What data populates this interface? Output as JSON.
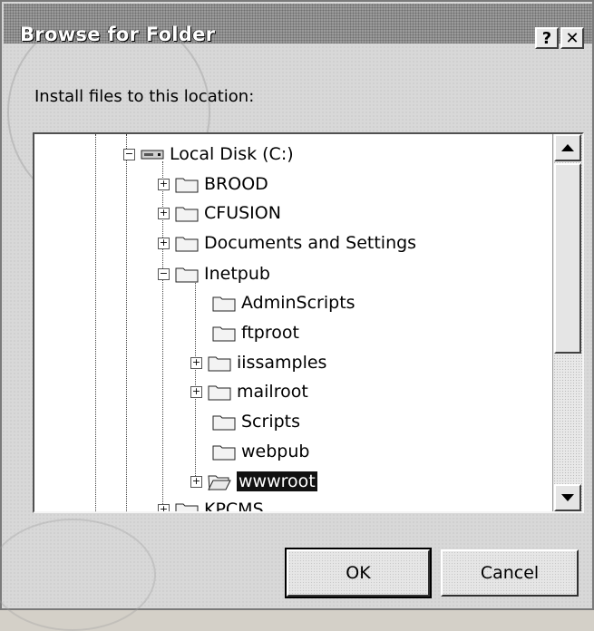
{
  "window": {
    "title": "Browse for Folder",
    "help_label": "?",
    "close_label": "✕"
  },
  "instruction": "Install files to this location:",
  "tree": {
    "items": [
      {
        "label": "Local Disk (C:)",
        "icon": "drive-icon",
        "expander": "−"
      },
      {
        "label": "BROOD",
        "icon": "folder-icon",
        "expander": "+"
      },
      {
        "label": "CFUSION",
        "icon": "folder-icon",
        "expander": "+"
      },
      {
        "label": "Documents and Settings",
        "icon": "folder-icon",
        "expander": "+"
      },
      {
        "label": "Inetpub",
        "icon": "folder-icon",
        "expander": "−"
      },
      {
        "label": "AdminScripts",
        "icon": "folder-icon",
        "expander": ""
      },
      {
        "label": "ftproot",
        "icon": "folder-icon",
        "expander": ""
      },
      {
        "label": "iissamples",
        "icon": "folder-icon",
        "expander": "+"
      },
      {
        "label": "mailroot",
        "icon": "folder-icon",
        "expander": "+"
      },
      {
        "label": "Scripts",
        "icon": "folder-icon",
        "expander": ""
      },
      {
        "label": "webpub",
        "icon": "folder-icon",
        "expander": ""
      },
      {
        "label": "wwwroot",
        "icon": "open-folder-icon",
        "expander": "+",
        "selected": true
      },
      {
        "label": "KPCMS",
        "icon": "folder-icon",
        "expander": "+"
      }
    ]
  },
  "buttons": {
    "ok": "OK",
    "cancel": "Cancel"
  }
}
